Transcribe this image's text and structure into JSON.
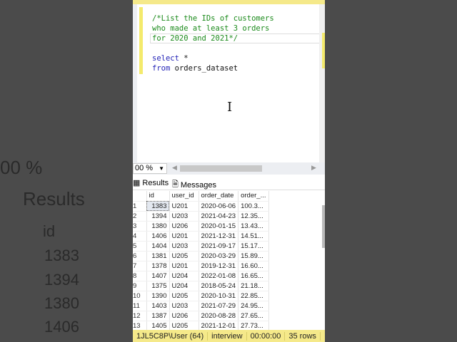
{
  "editor": {
    "lines": [
      {
        "cls": "cm",
        "text": "/*List the IDs of customers"
      },
      {
        "cls": "cm",
        "text": "who made at least 3 orders"
      },
      {
        "cls": "cm",
        "text": "for 2020 and 2021*/"
      },
      {
        "cls": "tx",
        "text": ""
      },
      {
        "cls": "kw",
        "text": "select",
        "rest": " *"
      },
      {
        "cls": "kw",
        "text": "from",
        "rest": " orders_dataset"
      }
    ]
  },
  "zoom": "00 %",
  "tabs": {
    "results": "Results",
    "messages": "Messages"
  },
  "grid": {
    "columns": [
      "id",
      "user_id",
      "order_date",
      "order_..."
    ],
    "rows": [
      [
        "1",
        "1383",
        "U201",
        "2020-06-06",
        "100.3..."
      ],
      [
        "2",
        "1394",
        "U203",
        "2021-04-23",
        "12.35..."
      ],
      [
        "3",
        "1380",
        "U206",
        "2020-01-15",
        "13.43..."
      ],
      [
        "4",
        "1406",
        "U201",
        "2021-12-31",
        "14.51..."
      ],
      [
        "5",
        "1404",
        "U203",
        "2021-09-17",
        "15.17..."
      ],
      [
        "6",
        "1381",
        "U205",
        "2020-03-29",
        "15.89..."
      ],
      [
        "7",
        "1378",
        "U201",
        "2019-12-31",
        "16.60..."
      ],
      [
        "8",
        "1407",
        "U204",
        "2022-01-08",
        "16.65..."
      ],
      [
        "9",
        "1375",
        "U204",
        "2018-05-24",
        "21.18..."
      ],
      [
        "10",
        "1390",
        "U205",
        "2020-10-31",
        "22.85..."
      ],
      [
        "11",
        "1403",
        "U203",
        "2021-07-29",
        "24.95..."
      ],
      [
        "12",
        "1387",
        "U206",
        "2020-08-28",
        "27.65..."
      ],
      [
        "13",
        "1405",
        "U205",
        "2021-12-01",
        "27.73..."
      ]
    ]
  },
  "status": {
    "user": "1JL5C8P\\User (64)",
    "db": "interview",
    "time": "00:00:00",
    "rows": "35 rows"
  }
}
